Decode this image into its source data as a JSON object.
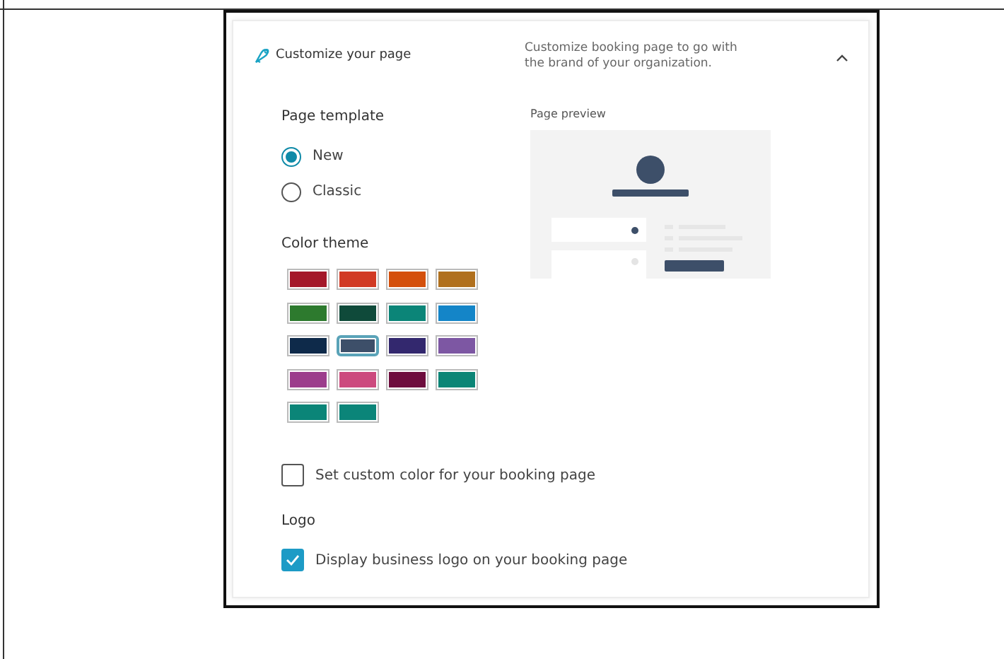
{
  "section": {
    "title": "Customize your page",
    "description_lines": [
      "Customize booking page to go with",
      "the brand of your organization."
    ],
    "expanded": true
  },
  "page_template": {
    "label": "Page template",
    "options": [
      {
        "label": "New",
        "selected": true
      },
      {
        "label": "Classic",
        "selected": false
      }
    ]
  },
  "color_theme": {
    "label": "Color theme",
    "swatches": [
      {
        "color": "#a4182a",
        "selected": false
      },
      {
        "color": "#d13a24",
        "selected": false
      },
      {
        "color": "#d4500c",
        "selected": false
      },
      {
        "color": "#b0701e",
        "selected": false
      },
      {
        "color": "#2d7a2e",
        "selected": false
      },
      {
        "color": "#0f4a3a",
        "selected": false
      },
      {
        "color": "#0b8578",
        "selected": false
      },
      {
        "color": "#1485c8",
        "selected": false
      },
      {
        "color": "#0e2a4a",
        "selected": false
      },
      {
        "color": "#3d4f69",
        "selected": true
      },
      {
        "color": "#33286e",
        "selected": false
      },
      {
        "color": "#7d57a3",
        "selected": false
      },
      {
        "color": "#9c3d8c",
        "selected": false
      },
      {
        "color": "#cc4a7e",
        "selected": false
      },
      {
        "color": "#6e0d3e",
        "selected": false
      },
      {
        "color": "#0b8576",
        "selected": false
      },
      {
        "color": "#0b8578",
        "selected": false
      },
      {
        "color": "#0b8579",
        "selected": false
      }
    ]
  },
  "preview": {
    "label": "Page preview"
  },
  "custom_color": {
    "label": "Set custom color for your booking page",
    "checked": false
  },
  "logo": {
    "label": "Logo",
    "option": {
      "label": "Display business logo on your booking page",
      "checked": true
    }
  }
}
